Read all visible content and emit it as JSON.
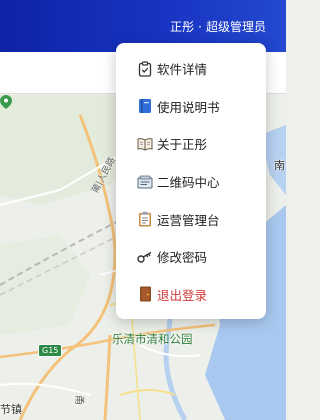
{
  "header": {
    "app_name": "正彤",
    "separator": "·",
    "role": "超级管理员"
  },
  "map": {
    "park_label": "乐清市清和公园",
    "road_label": "莆|人民路",
    "road_label_south": "甬",
    "town_label": "节镇",
    "east_label": "南",
    "highway_badge": "G15"
  },
  "menu": {
    "items": [
      {
        "id": "software-details",
        "icon": "clipboard-check-icon",
        "label": "软件详情"
      },
      {
        "id": "user-manual",
        "icon": "blue-book-icon",
        "label": "使用说明书"
      },
      {
        "id": "about",
        "icon": "open-book-icon",
        "label": "关于正彤"
      },
      {
        "id": "qr-center",
        "icon": "card-index-icon",
        "label": "二维码中心"
      },
      {
        "id": "ops-console",
        "icon": "clipboard-icon",
        "label": "运营管理台"
      },
      {
        "id": "change-password",
        "icon": "key-icon",
        "label": "修改密码"
      },
      {
        "id": "logout",
        "icon": "door-icon",
        "label": "退出登录"
      }
    ]
  },
  "colors": {
    "header_start": "#0d23a6",
    "header_end": "#2448cf",
    "logout_text": "#d33a3a",
    "park_green": "#2f7d3a",
    "water": "#a9c8ef"
  }
}
